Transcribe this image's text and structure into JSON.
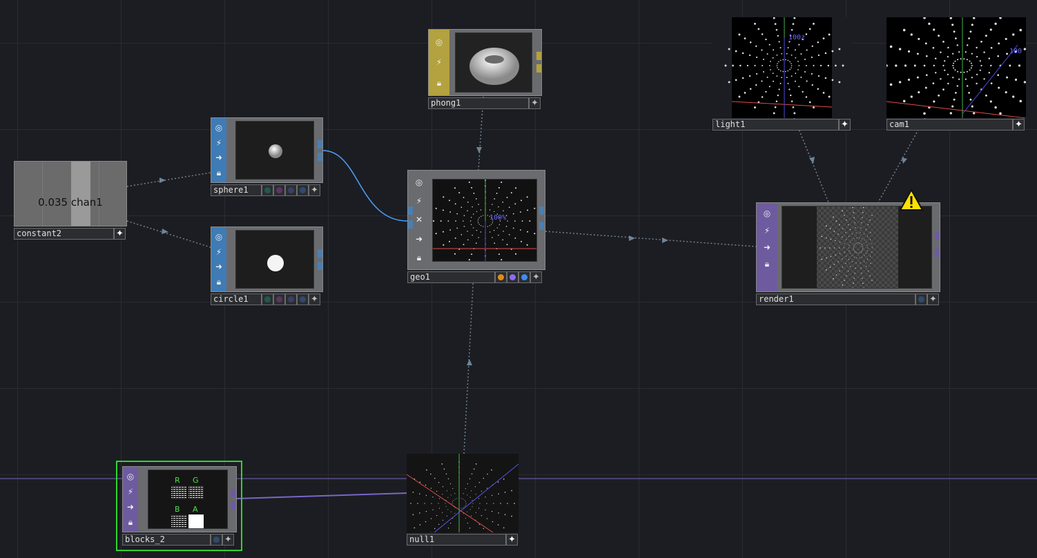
{
  "nodes": {
    "constant2": {
      "label": "constant2",
      "value_text": "0.035 chan1"
    },
    "sphere1": {
      "label": "sphere1"
    },
    "circle1": {
      "label": "circle1"
    },
    "phong1": {
      "label": "phong1"
    },
    "geo1": {
      "label": "geo1",
      "overlay": "100%"
    },
    "light1": {
      "label": "light1",
      "overlay": "100z"
    },
    "cam1": {
      "label": "cam1",
      "overlay": "100"
    },
    "render1": {
      "label": "render1"
    },
    "blocks_2": {
      "label": "blocks_2",
      "channels": [
        "R",
        "G",
        "B",
        "A"
      ]
    },
    "null1": {
      "label": "null1"
    }
  },
  "icons": {
    "viewer": "target-icon",
    "bypass": "lightning-icon",
    "cook": "x-icon",
    "display": "arrow-right-icon",
    "lock": "lock-icon",
    "warning": "warning-icon",
    "add": "plus-icon"
  },
  "colors": {
    "background": "#1c1d22",
    "sop": "#3f7bb5",
    "mat": "#b3a23f",
    "top": "#6e5b9f",
    "selection": "#31d431",
    "wire_sop": "#4aa3ff",
    "wire_top": "#7a66c9"
  }
}
